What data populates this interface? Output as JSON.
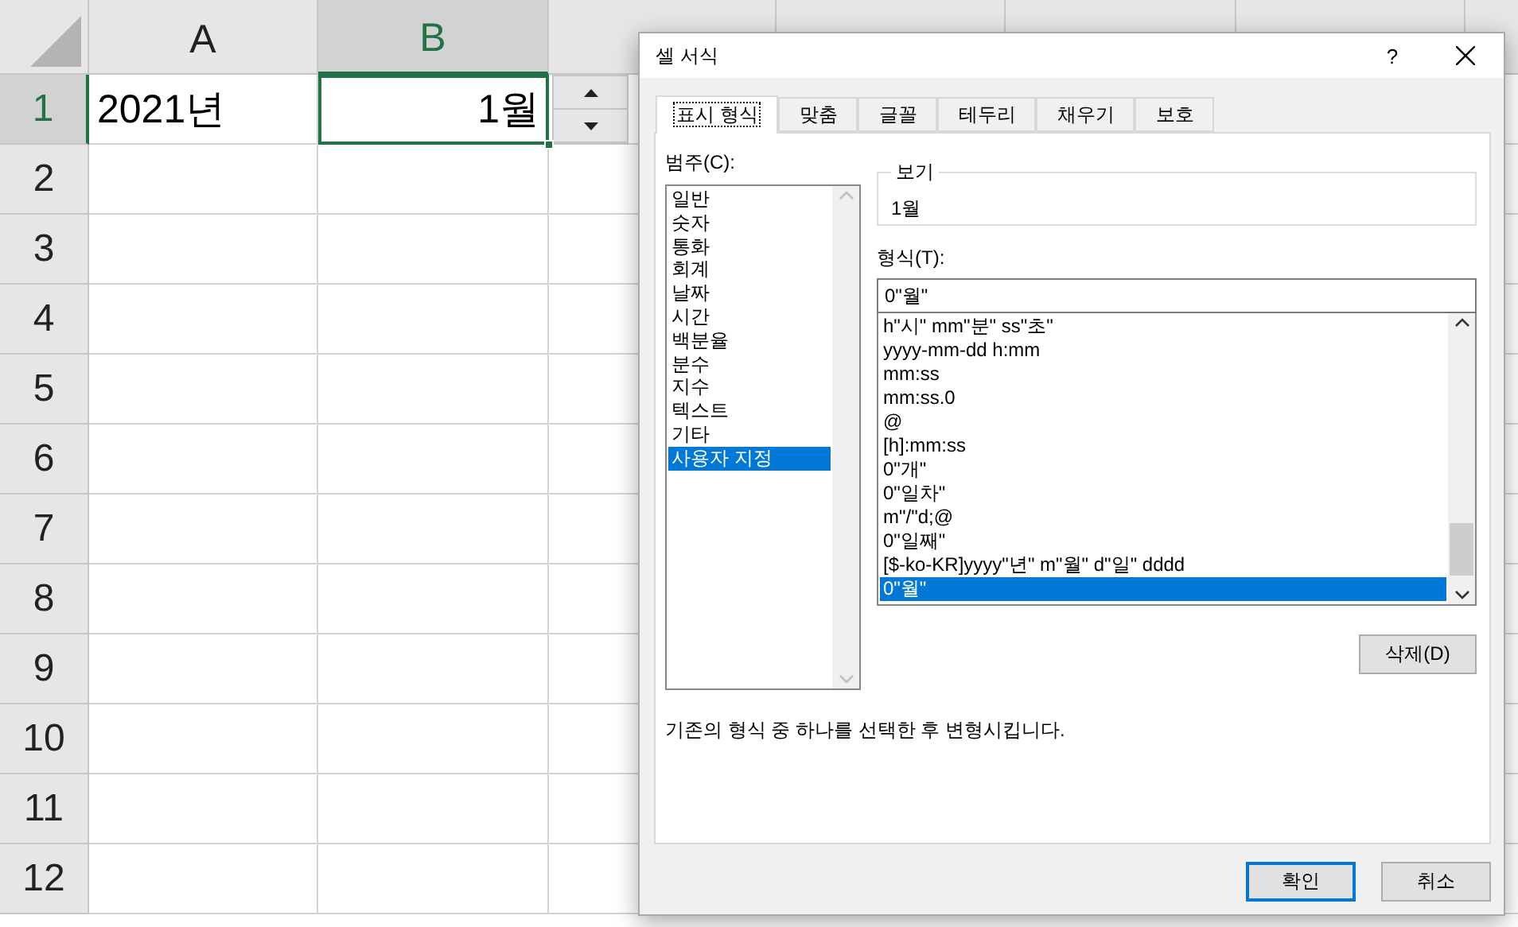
{
  "sheet": {
    "columns": [
      {
        "label": "A",
        "selected": false
      },
      {
        "label": "B",
        "selected": true
      }
    ],
    "rows": [
      {
        "label": "1",
        "selected": true,
        "cells": [
          {
            "value": "2021년",
            "kind": "text",
            "selected": false
          },
          {
            "value": "1월",
            "kind": "number",
            "selected": true
          }
        ]
      },
      {
        "label": "2",
        "selected": false
      },
      {
        "label": "3",
        "selected": false
      },
      {
        "label": "4",
        "selected": false
      },
      {
        "label": "5",
        "selected": false
      },
      {
        "label": "6",
        "selected": false
      },
      {
        "label": "7",
        "selected": false
      },
      {
        "label": "8",
        "selected": false
      },
      {
        "label": "9",
        "selected": false
      },
      {
        "label": "10",
        "selected": false
      },
      {
        "label": "11",
        "selected": false
      },
      {
        "label": "12",
        "selected": false
      }
    ]
  },
  "dialog": {
    "title": "셀 서식",
    "help": "?",
    "tabs": [
      {
        "label": "표시 형식",
        "selected": true
      },
      {
        "label": "맞춤",
        "selected": false
      },
      {
        "label": "글꼴",
        "selected": false
      },
      {
        "label": "테두리",
        "selected": false
      },
      {
        "label": "채우기",
        "selected": false
      },
      {
        "label": "보호",
        "selected": false
      }
    ],
    "category_label": "범주(C):",
    "categories": [
      {
        "label": "일반",
        "selected": false
      },
      {
        "label": "숫자",
        "selected": false
      },
      {
        "label": "통화",
        "selected": false
      },
      {
        "label": "회계",
        "selected": false
      },
      {
        "label": "날짜",
        "selected": false
      },
      {
        "label": "시간",
        "selected": false
      },
      {
        "label": "백분율",
        "selected": false
      },
      {
        "label": "분수",
        "selected": false
      },
      {
        "label": "지수",
        "selected": false
      },
      {
        "label": "텍스트",
        "selected": false
      },
      {
        "label": "기타",
        "selected": false
      },
      {
        "label": "사용자 지정",
        "selected": true
      }
    ],
    "sample": {
      "legend": "보기",
      "value": "1월"
    },
    "format_label": "형식(T):",
    "format_value": "0\"월\"",
    "formats": [
      {
        "label": "h\"시\" mm\"분\" ss\"초\"",
        "selected": false
      },
      {
        "label": "yyyy-mm-dd h:mm",
        "selected": false
      },
      {
        "label": "mm:ss",
        "selected": false
      },
      {
        "label": "mm:ss.0",
        "selected": false
      },
      {
        "label": "@",
        "selected": false
      },
      {
        "label": "[h]:mm:ss",
        "selected": false
      },
      {
        "label": "0\"개\"",
        "selected": false
      },
      {
        "label": "0\"일차\"",
        "selected": false
      },
      {
        "label": "m\"/\"d;@",
        "selected": false
      },
      {
        "label": "0\"일째\"",
        "selected": false
      },
      {
        "label": "[$-ko-KR]yyyy\"년\" m\"월\" d\"일\" dddd",
        "selected": false
      },
      {
        "label": "0\"월\"",
        "selected": true
      }
    ],
    "delete_button": "삭제(D)",
    "hint": "기존의 형식 중 하나를 선택한 후 변형시킵니다.",
    "buttons": [
      {
        "label": "확인",
        "default": true
      },
      {
        "label": "취소",
        "default": false
      }
    ]
  }
}
